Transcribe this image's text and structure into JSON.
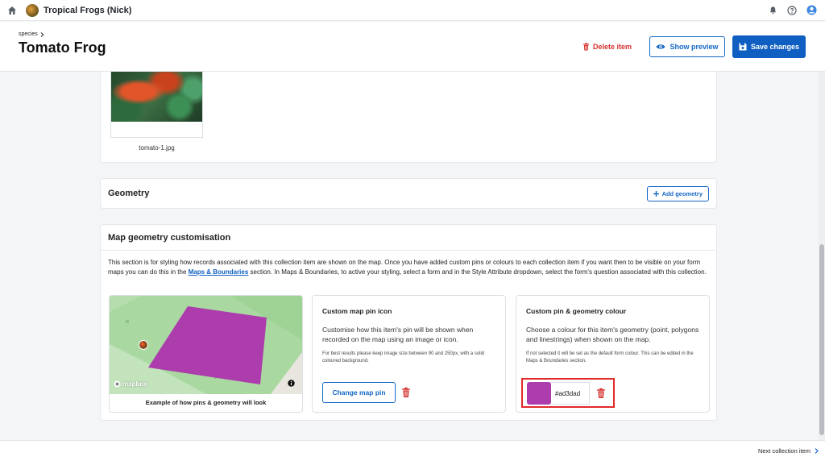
{
  "topbar": {
    "project_title": "Tropical Frogs (Nick)",
    "icons": [
      "home-icon",
      "bell-icon",
      "help-icon",
      "user-avatar-icon"
    ]
  },
  "header": {
    "breadcrumb": "species",
    "title": "Tomato Frog",
    "delete_label": "Delete item",
    "preview_label": "Show preview",
    "save_label": "Save changes"
  },
  "image_card": {
    "filename": "tomato-1.jpg"
  },
  "geometry": {
    "title": "Geometry",
    "add_label": "Add geometry"
  },
  "customisation": {
    "title": "Map geometry customisation",
    "desc_part1": "This section is for styling how records associated with this collection item are shown on the map. Once you have added custom pins or colours to each collection item if you want then to be visible on your form maps you can do this in the ",
    "desc_link": "Maps & Boundaries",
    "desc_part2": " section. In Maps & Boundaries, to active your styling, select a form and in the Style Attribute dropdown, select the form's question associated with this collection.",
    "map_preview": {
      "caption": "Example of how pins & geometry will look",
      "logo": "mapbox"
    },
    "pin": {
      "heading": "Custom map pin icon",
      "text": "Customise how this item's pin will be shown when recorded on the map using an image or icon.",
      "hint": "For best results please keep image size between 90 and 250px, with a solid coloured background.",
      "button_label": "Change map pin"
    },
    "colour": {
      "heading": "Custom pin & geometry colour",
      "text": "Choose a colour for this item's geometry (point, polygons and linestrings) when shown on the map.",
      "hint": "If not selected it will be set as the default form colour. This can be edited in the Maps & Boundaries section.",
      "value": "#ad3dad"
    }
  },
  "colors": {
    "accent": "#0f5fc2",
    "danger": "#d6332f",
    "geometry": "#ad3dad",
    "highlight": "#e02a2a"
  },
  "footer": {
    "next_label": "Next collection item"
  }
}
